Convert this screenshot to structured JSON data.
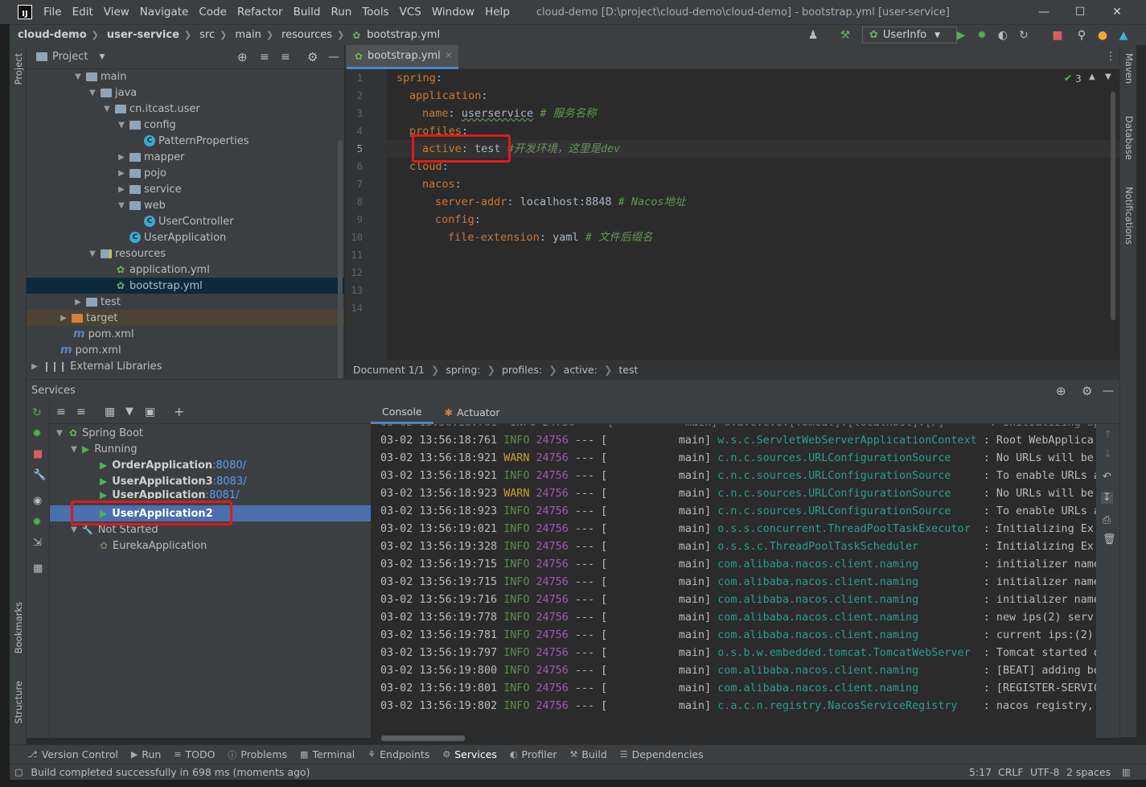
{
  "menu": [
    "File",
    "Edit",
    "View",
    "Navigate",
    "Code",
    "Refactor",
    "Build",
    "Run",
    "Tools",
    "VCS",
    "Window",
    "Help"
  ],
  "window_title": "cloud-demo [D:\\project\\cloud-demo\\cloud-demo] - bootstrap.yml [user-service]",
  "breadcrumb": {
    "project": "cloud-demo",
    "module": "user-service",
    "p1": "src",
    "p2": "main",
    "p3": "resources",
    "file": "bootstrap.yml"
  },
  "run_config": "UserInfo",
  "left_stripe": {
    "project": "Project",
    "bookmarks": "Bookmarks",
    "structure": "Structure"
  },
  "right_stripe": {
    "maven": "Maven",
    "database": "Database",
    "notifications": "Notifications"
  },
  "project_panel": {
    "title": "Project",
    "tree": [
      {
        "label": "main"
      },
      {
        "label": "java"
      },
      {
        "label": "cn.itcast.user"
      },
      {
        "label": "config"
      },
      {
        "label": "PatternProperties"
      },
      {
        "label": "mapper"
      },
      {
        "label": "pojo"
      },
      {
        "label": "service"
      },
      {
        "label": "web"
      },
      {
        "label": "UserController"
      },
      {
        "label": "UserApplication"
      },
      {
        "label": "resources"
      },
      {
        "label": "application.yml"
      },
      {
        "label": "bootstrap.yml"
      },
      {
        "label": "test"
      },
      {
        "label": "target"
      },
      {
        "label": "pom.xml"
      },
      {
        "label": "pom.xml"
      },
      {
        "label": "External Libraries"
      }
    ]
  },
  "editor": {
    "tab": "bootstrap.yml",
    "inspection_count": "3",
    "line_numbers": [
      "1",
      "2",
      "3",
      "4",
      "5",
      "6",
      "7",
      "8",
      "9",
      "10",
      "11",
      "12",
      "13",
      "14"
    ],
    "code": {
      "l1_key": "spring",
      "l2_key": "application",
      "l3_key": "name",
      "l3_val": "userservice",
      "l3_comment": "# 服务名称",
      "l4_key": "profiles",
      "l5_key": "active",
      "l5_val": "test",
      "l5_comment": "#开发环境，这里是dev",
      "l6_key": "cloud",
      "l7_key": "nacos",
      "l8_key": "server-addr",
      "l8_val": "localhost:8848",
      "l8_comment": "# Nacos地址",
      "l9_key": "config",
      "l10_key": "file-extension",
      "l10_val": "yaml",
      "l10_comment": "# 文件后缀名"
    },
    "breadcrumb": [
      "Document 1/1",
      "spring:",
      "profiles:",
      "active:",
      "test"
    ]
  },
  "services": {
    "title": "Services",
    "tree": {
      "root": "Spring Boot",
      "running": "Running",
      "apps": [
        {
          "name": "OrderApplication",
          "port": ":8080/"
        },
        {
          "name": "UserApplication3",
          "port": ":8083/"
        },
        {
          "name": "UserApplication",
          "port": ":8081/"
        },
        {
          "name": "UserApplication2",
          "port": ""
        }
      ],
      "not_started": "Not Started",
      "not_started_apps": [
        "EurekaApplication"
      ]
    },
    "console_tabs": [
      "Console",
      "Actuator"
    ],
    "log": [
      {
        "ts": "03-02 13:56:18:761",
        "level": "INFO",
        "pid": "24756",
        "sep": "---",
        "thread": "[           main]",
        "logger": "w.s.c.ServletWebServerApplicationContext",
        "msg": ": Root WebApplica"
      },
      {
        "ts": "03-02 13:56:18:921",
        "level": "WARN",
        "pid": "24756",
        "sep": "---",
        "thread": "[           main]",
        "logger": "c.n.c.sources.URLConfigurationSource    ",
        "msg": ": No URLs will be"
      },
      {
        "ts": "03-02 13:56:18:921",
        "level": "INFO",
        "pid": "24756",
        "sep": "---",
        "thread": "[           main]",
        "logger": "c.n.c.sources.URLConfigurationSource    ",
        "msg": ": To enable URLs a"
      },
      {
        "ts": "03-02 13:56:18:923",
        "level": "WARN",
        "pid": "24756",
        "sep": "---",
        "thread": "[           main]",
        "logger": "c.n.c.sources.URLConfigurationSource    ",
        "msg": ": No URLs will be"
      },
      {
        "ts": "03-02 13:56:18:923",
        "level": "INFO",
        "pid": "24756",
        "sep": "---",
        "thread": "[           main]",
        "logger": "c.n.c.sources.URLConfigurationSource    ",
        "msg": ": To enable URLs a"
      },
      {
        "ts": "03-02 13:56:19:021",
        "level": "INFO",
        "pid": "24756",
        "sep": "---",
        "thread": "[           main]",
        "logger": "o.s.s.concurrent.ThreadPoolTaskExecutor ",
        "msg": ": Initializing Ex"
      },
      {
        "ts": "03-02 13:56:19:328",
        "level": "INFO",
        "pid": "24756",
        "sep": "---",
        "thread": "[           main]",
        "logger": "o.s.s.c.ThreadPoolTaskScheduler         ",
        "msg": ": Initializing Ex"
      },
      {
        "ts": "03-02 13:56:19:715",
        "level": "INFO",
        "pid": "24756",
        "sep": "---",
        "thread": "[           main]",
        "logger": "com.alibaba.nacos.client.naming         ",
        "msg": ": initializer name"
      },
      {
        "ts": "03-02 13:56:19:715",
        "level": "INFO",
        "pid": "24756",
        "sep": "---",
        "thread": "[           main]",
        "logger": "com.alibaba.nacos.client.naming         ",
        "msg": ": initializer name"
      },
      {
        "ts": "03-02 13:56:19:716",
        "level": "INFO",
        "pid": "24756",
        "sep": "---",
        "thread": "[           main]",
        "logger": "com.alibaba.nacos.client.naming         ",
        "msg": ": initializer name"
      },
      {
        "ts": "03-02 13:56:19:778",
        "level": "INFO",
        "pid": "24756",
        "sep": "---",
        "thread": "[           main]",
        "logger": "com.alibaba.nacos.client.naming         ",
        "msg": ": new ips(2) serv"
      },
      {
        "ts": "03-02 13:56:19:781",
        "level": "INFO",
        "pid": "24756",
        "sep": "---",
        "thread": "[           main]",
        "logger": "com.alibaba.nacos.client.naming         ",
        "msg": ": current ips:(2)"
      },
      {
        "ts": "03-02 13:56:19:797",
        "level": "INFO",
        "pid": "24756",
        "sep": "---",
        "thread": "[           main]",
        "logger": "o.s.b.w.embedded.tomcat.TomcatWebServer ",
        "msg": ": Tomcat started o"
      },
      {
        "ts": "03-02 13:56:19:800",
        "level": "INFO",
        "pid": "24756",
        "sep": "---",
        "thread": "[           main]",
        "logger": "com.alibaba.nacos.client.naming         ",
        "msg": ": [BEAT] adding be"
      },
      {
        "ts": "03-02 13:56:19:801",
        "level": "INFO",
        "pid": "24756",
        "sep": "---",
        "thread": "[           main]",
        "logger": "com.alibaba.nacos.client.naming         ",
        "msg": ": [REGISTER-SERVIC"
      },
      {
        "ts": "03-02 13:56:19:802",
        "level": "INFO",
        "pid": "24756",
        "sep": "---",
        "thread": "[           main]",
        "logger": "c.a.c.n.registry.NacosServiceRegistry   ",
        "msg": ": nacos registry,"
      }
    ]
  },
  "bottom_tabs": [
    "Version Control",
    "Run",
    "TODO",
    "Problems",
    "Terminal",
    "Endpoints",
    "Services",
    "Profiler",
    "Build",
    "Dependencies"
  ],
  "status": {
    "message": "Build completed successfully in 698 ms (moments ago)",
    "position": "5:17",
    "line_sep": "CRLF",
    "encoding": "UTF-8",
    "indent": "2 spaces"
  },
  "colors": {
    "highlight_box": "#e31919",
    "selection": "#4b6eaf",
    "keyword": "#cc7832",
    "comment": "#629755"
  }
}
